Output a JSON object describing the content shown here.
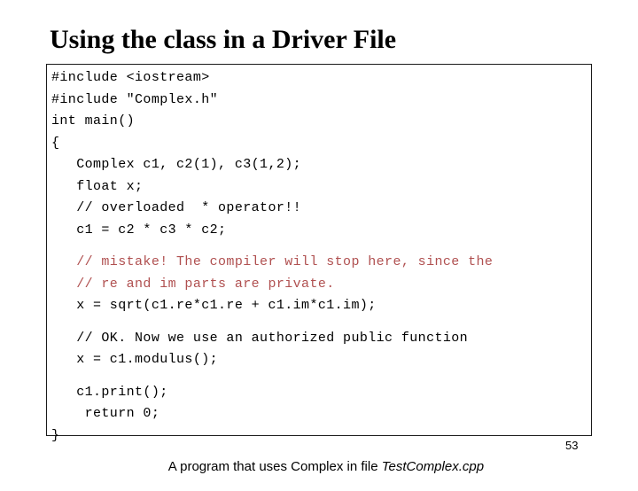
{
  "slide": {
    "title": "Using the class in a Driver File",
    "page_number": "53",
    "colors": {
      "text": "#000000",
      "comment_error": "#b05050",
      "box_border": "#1a1a1a",
      "background": "#ffffff"
    }
  },
  "code": {
    "language": "cpp",
    "lines": [
      {
        "text": "#include <iostream>",
        "style": "normal"
      },
      {
        "text": "#include \"Complex.h\"",
        "style": "normal"
      },
      {
        "text": "int main()",
        "style": "normal"
      },
      {
        "text": "{",
        "style": "normal"
      },
      {
        "text": "   Complex c1, c2(1), c3(1,2);",
        "style": "normal"
      },
      {
        "text": "   float x;",
        "style": "normal"
      },
      {
        "text": "   // overloaded  * operator!!",
        "style": "normal"
      },
      {
        "text": "   c1 = c2 * c3 * c2;",
        "style": "normal"
      },
      {
        "text": "",
        "style": "blank"
      },
      {
        "text": "   // mistake! The compiler will stop here, since the",
        "style": "comment-error"
      },
      {
        "text": "   // re and im parts are private.",
        "style": "comment-error"
      },
      {
        "text": "   x = sqrt(c1.re*c1.re + c1.im*c1.im);",
        "style": "normal"
      },
      {
        "text": "",
        "style": "blank"
      },
      {
        "text": "   // OK. Now we use an authorized public function",
        "style": "normal"
      },
      {
        "text": "   x = c1.modulus();",
        "style": "normal"
      },
      {
        "text": "",
        "style": "blank"
      },
      {
        "text": "   c1.print();",
        "style": "normal"
      },
      {
        "text": "    return 0;",
        "style": "normal"
      },
      {
        "text": "}",
        "style": "normal"
      }
    ]
  },
  "caption": {
    "prefix": "A program that uses Complex in file ",
    "filename": "TestComplex.cpp"
  }
}
